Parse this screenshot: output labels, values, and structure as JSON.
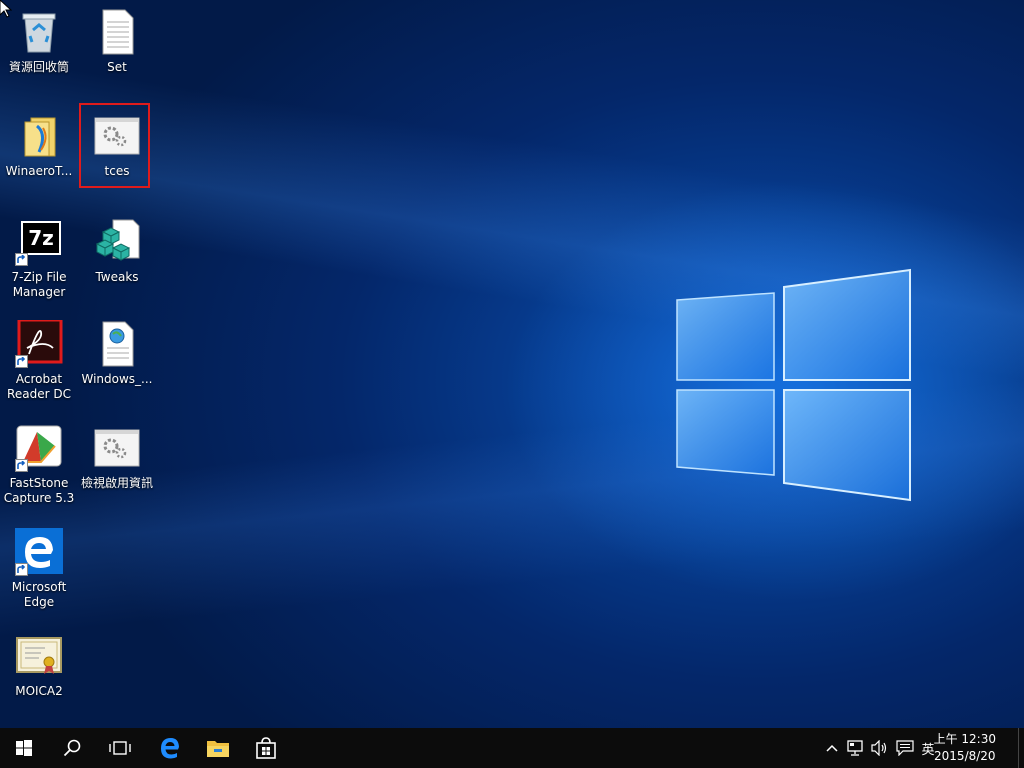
{
  "desktop": {
    "icons": [
      {
        "label": "資源回收筒",
        "name": "recycle-bin-icon"
      },
      {
        "label": "Set",
        "name": "text-file-icon"
      },
      {
        "label": "WinaeroT...",
        "name": "folder-icon"
      },
      {
        "label": "tces",
        "name": "settings-file-icon"
      },
      {
        "label": "7-Zip File Manager",
        "name": "7zip-icon"
      },
      {
        "label": "Tweaks",
        "name": "registry-icon"
      },
      {
        "label": "Acrobat Reader DC",
        "name": "acrobat-icon"
      },
      {
        "label": "Windows_...",
        "name": "web-document-icon"
      },
      {
        "label": "FastStone Capture 5.3",
        "name": "faststone-icon"
      },
      {
        "label": "檢視啟用資訊",
        "name": "settings-file-icon"
      },
      {
        "label": "Microsoft Edge",
        "name": "edge-icon"
      },
      {
        "label": "MOICA2",
        "name": "certificate-icon"
      }
    ],
    "sevenzip_glyph": "7z"
  },
  "taskbar": {
    "start": "start-icon",
    "search": "search-icon",
    "task_view": "task-view-icon",
    "pinned": [
      "edge-icon",
      "file-explorer-icon",
      "store-icon"
    ],
    "tray": {
      "chevron": "^",
      "network": "network-icon",
      "volume": "volume-icon",
      "notifications": "action-center-icon",
      "ime": "英"
    },
    "clock": {
      "time": "上午 12:30",
      "date": "2015/8/20"
    }
  },
  "colors": {
    "selection_border": "#e01b1b",
    "taskbar": "#0c0c0c",
    "accent": "#1e8cff"
  }
}
